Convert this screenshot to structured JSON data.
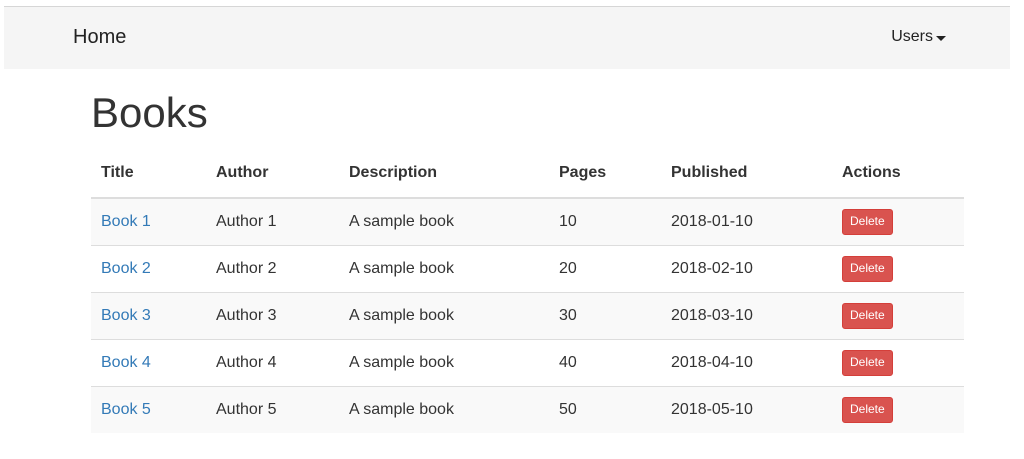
{
  "navbar": {
    "brand": "Home",
    "users_menu": "Users"
  },
  "page_title": "Books",
  "table": {
    "headers": [
      "Title",
      "Author",
      "Description",
      "Pages",
      "Published",
      "Actions"
    ],
    "rows": [
      {
        "title": "Book 1",
        "author": "Author 1",
        "description": "A sample book",
        "pages": "10",
        "published": "2018-01-10",
        "action": "Delete"
      },
      {
        "title": "Book 2",
        "author": "Author 2",
        "description": "A sample book",
        "pages": "20",
        "published": "2018-02-10",
        "action": "Delete"
      },
      {
        "title": "Book 3",
        "author": "Author 3",
        "description": "A sample book",
        "pages": "30",
        "published": "2018-03-10",
        "action": "Delete"
      },
      {
        "title": "Book 4",
        "author": "Author 4",
        "description": "A sample book",
        "pages": "40",
        "published": "2018-04-10",
        "action": "Delete"
      },
      {
        "title": "Book 5",
        "author": "Author 5",
        "description": "A sample book",
        "pages": "50",
        "published": "2018-05-10",
        "action": "Delete"
      }
    ]
  },
  "colors": {
    "navbar_bg": "#f5f5f5",
    "link": "#337ab7",
    "danger": "#d9534f",
    "stripe": "#f9f9f9"
  },
  "icons": {
    "users_dropdown": "caret-down-icon"
  }
}
